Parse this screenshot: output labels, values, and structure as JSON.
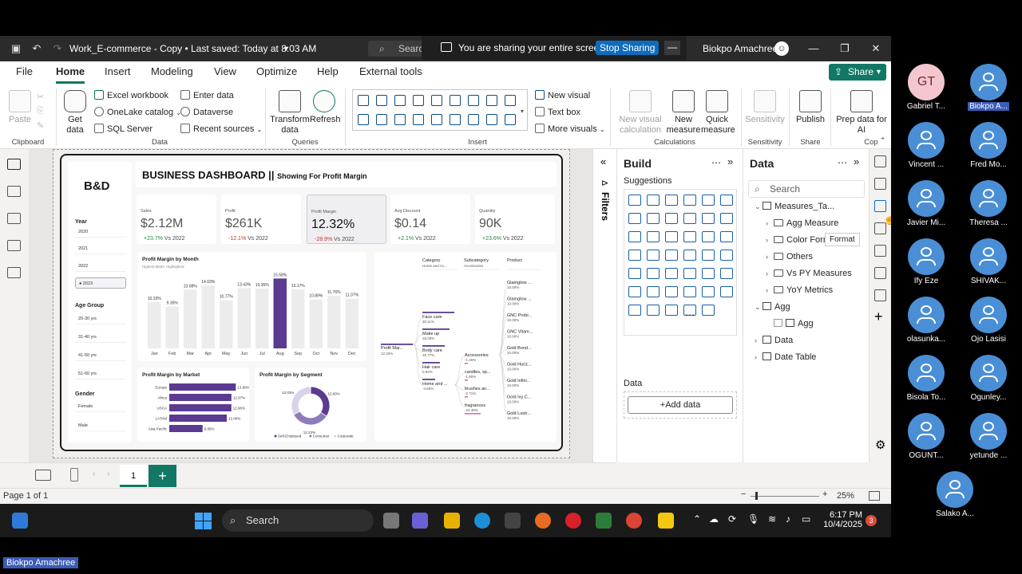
{
  "window": {
    "title": "Work_E-commerce - Copy • Last saved: Today at 8:03 AM",
    "search_placeholder": "Search",
    "user": "Biokpo Amachree"
  },
  "sharing": {
    "text": "You are sharing your entire screen.",
    "stop_label": "Stop Sharing",
    "min_label": "—"
  },
  "menu": {
    "items": [
      "File",
      "Home",
      "Insert",
      "Modeling",
      "View",
      "Optimize",
      "Help",
      "External tools"
    ],
    "active": "Home",
    "share_label": "Share"
  },
  "ribbon": {
    "clipboard": {
      "paste": "Paste",
      "label": "Clipboard"
    },
    "data": {
      "get_data": "Get data",
      "excel": "Excel workbook",
      "onelake": "OneLake catalog",
      "sql": "SQL Server",
      "enter": "Enter data",
      "dataverse": "Dataverse",
      "recent": "Recent sources",
      "label": "Data"
    },
    "queries": {
      "transform": "Transform data",
      "refresh": "Refresh",
      "label": "Queries"
    },
    "insert": {
      "new_visual": "New visual",
      "text_box": "Text box",
      "more_visuals": "More visuals",
      "label": "Insert"
    },
    "calculations": {
      "new_visual_calc": "New visual calculation",
      "new_measure": "New measure",
      "quick_measure": "Quick measure",
      "label": "Calculations"
    },
    "sensitivity": {
      "btn": "Sensitivity",
      "label": "Sensitivity"
    },
    "share": {
      "publish": "Publish",
      "label": "Share"
    },
    "copilot": {
      "prep": "Prep data for AI",
      "label": "Cop"
    }
  },
  "dashboard": {
    "brand": "B&D",
    "title": "BUSINESS DASHBOARD ||",
    "subtitle": "Showing For Profit Margin",
    "year_label": "Year",
    "years": [
      "2020",
      "2021",
      "2022",
      "2023"
    ],
    "selected_year": "2023",
    "age_label": "Age Group",
    "ages": [
      "20-30 yrs",
      "31-40 yrs",
      "41-50 yrs",
      "51-60 yrs"
    ],
    "gender_label": "Gender",
    "genders": [
      "Female",
      "Male"
    ],
    "kpis": [
      {
        "label": "Sales",
        "value": "$2.12M",
        "delta": "+23.7%",
        "vs": "Vs 2022",
        "dir": "pos"
      },
      {
        "label": "Profit",
        "value": "$261K",
        "delta": "-12.1%",
        "vs": "Vs 2022",
        "dir": "neg"
      },
      {
        "label": "Profit Margin",
        "value": "12.32%",
        "delta": "-28.9%",
        "vs": "Vs 2022",
        "dir": "neg"
      },
      {
        "label": "Avg Discount",
        "value": "$0.14",
        "delta": "+2.1%",
        "vs": "Vs 2022",
        "dir": "pos"
      },
      {
        "label": "Quantity",
        "value": "90K",
        "delta": "+23.6%",
        "vs": "Vs 2022",
        "dir": "pos"
      }
    ],
    "month_chart": {
      "title": "Profit Margin by Month",
      "subtitle": "Highest Metric Highlighted"
    },
    "market_chart": {
      "title": "Profit Margin by Market"
    },
    "segment_chart": {
      "title": "Profit Margin by Segment"
    },
    "tree": {
      "headers": [
        {
          "h": "Category",
          "s": "Home and Ac..."
        },
        {
          "h": "Subcategory",
          "s": "Accessories"
        },
        {
          "h": "Product",
          "s": ""
        }
      ],
      "root": {
        "label": "Profit Mar...",
        "value": "12.32%"
      },
      "categories": [
        {
          "label": "Face care",
          "value": "30.11%"
        },
        {
          "label": "Make up",
          "value": "25.00%"
        },
        {
          "label": "Body care",
          "value": "16.77%"
        },
        {
          "label": "Hair care",
          "value": "0.92%"
        },
        {
          "label": "Home and ...",
          "value": "-4.60%"
        }
      ],
      "subcategories": [
        {
          "label": "Accessories",
          "value": "-1.45%"
        },
        {
          "label": "candles, sp...",
          "value": "-1.80%"
        },
        {
          "label": "brushes an...",
          "value": "-2.71%"
        },
        {
          "label": "fragrances",
          "value": "-24.38%"
        }
      ],
      "products": [
        {
          "label": "Glamglow ...",
          "value": "10.00%"
        },
        {
          "label": "Glamglow ...",
          "value": "10.00%"
        },
        {
          "label": "GNC Probi...",
          "value": "10.00%"
        },
        {
          "label": "GNC Vitam...",
          "value": "10.00%"
        },
        {
          "label": "Gold Bond...",
          "value": "10.00%"
        },
        {
          "label": "Gold Horiz...",
          "value": "10.00%"
        },
        {
          "label": "Gold Infini...",
          "value": "10.00%"
        },
        {
          "label": "Gold Ivy C...",
          "value": "10.00%"
        },
        {
          "label": "Gold Lustr...",
          "value": "10.00%"
        }
      ]
    }
  },
  "chart_data": [
    {
      "type": "bar",
      "title": "Profit Margin by Month",
      "subtitle": "Highest Metric Highlighted",
      "categories": [
        "Jan",
        "Feb",
        "Mar",
        "Apr",
        "May",
        "Jun",
        "Jul",
        "Aug",
        "Sep",
        "Oct",
        "Nov",
        "Dec"
      ],
      "values": [
        10.33,
        9.35,
        13.08,
        14.03,
        10.77,
        13.43,
        13.35,
        15.58,
        13.17,
        10.89,
        11.76,
        11.07
      ],
      "labels": [
        "10.33%",
        "9.35%",
        "13.08%",
        "14.03%",
        "10.77%",
        "13.43%",
        "13.35%",
        "15.58%",
        "13.17%",
        "10.89%",
        "11.76%",
        "11.07%"
      ],
      "highlight": "Aug",
      "ylim": [
        0,
        16
      ]
    },
    {
      "type": "bar",
      "orientation": "horizontal",
      "title": "Profit Margin by Market",
      "categories": [
        "Europe",
        "Africa",
        "USCA",
        "LATAM",
        "Asia Pacific"
      ],
      "values": [
        13.89,
        12.97,
        12.96,
        12.0,
        6.95
      ],
      "labels": [
        "13.89%",
        "12.97%",
        "12.96%",
        "12.00%",
        "6.95%"
      ],
      "xlim": [
        0,
        14
      ]
    },
    {
      "type": "pie",
      "donut": true,
      "title": "Profit Margin by Segment",
      "categories": [
        "Self-Employed",
        "Consumer",
        "Corporate"
      ],
      "values": [
        12.6,
        12.23,
        12.03
      ],
      "labels": [
        "12.60%",
        "12.23%",
        "12.03%"
      ],
      "colors": [
        "#5b3a91",
        "#8e7bbd",
        "#d9d2ea"
      ],
      "legend": "bottom"
    }
  ],
  "panes": {
    "filters": "Filters",
    "build": {
      "title": "Build",
      "suggestions": "Suggestions",
      "data_label": "Data",
      "add_data": "+Add data"
    },
    "data": {
      "title": "Data",
      "search_placeholder": "Search",
      "tooltip": "Format",
      "tree": [
        {
          "text": "Measures_Ta...",
          "level": 0,
          "kind": "table",
          "open": true
        },
        {
          "text": "Agg Measure",
          "level": 1,
          "kind": "folder"
        },
        {
          "text": "Color Format",
          "level": 1,
          "kind": "folder"
        },
        {
          "text": "Others",
          "level": 1,
          "kind": "folder"
        },
        {
          "text": "Vs PY Measures",
          "level": 1,
          "kind": "folder"
        },
        {
          "text": "YoY Metrics",
          "level": 1,
          "kind": "folder"
        },
        {
          "text": "Agg",
          "level": 0,
          "kind": "table",
          "open": true
        },
        {
          "text": "Agg",
          "level": 1,
          "kind": "field"
        },
        {
          "text": "Data",
          "level": 0,
          "kind": "table",
          "open": false
        },
        {
          "text": "Date Table",
          "level": 0,
          "kind": "table",
          "open": false
        }
      ]
    }
  },
  "pages": {
    "current": "1",
    "add": "+"
  },
  "status": {
    "page": "Page 1 of 1",
    "zoom": "25%"
  },
  "taskbar": {
    "search": "Search",
    "time": "6:17 PM",
    "date": "10/4/2025",
    "badge": "3"
  },
  "participants": [
    {
      "name": "Gabriel T...",
      "initials": "GT"
    },
    {
      "name": "Biokpo A...",
      "highlight": true
    },
    {
      "name": "Vincent ..."
    },
    {
      "name": "Fred Mo..."
    },
    {
      "name": "Javier Mi..."
    },
    {
      "name": "Theresa ..."
    },
    {
      "name": "Ify Eze"
    },
    {
      "name": "SHIVAK..."
    },
    {
      "name": "olasunka..."
    },
    {
      "name": "Ojo Lasisi"
    },
    {
      "name": "Bisola To..."
    },
    {
      "name": "Ogunley..."
    },
    {
      "name": "OGUNT..."
    },
    {
      "name": "yetunde ..."
    },
    {
      "name": "Salako A..."
    }
  ],
  "presenter_tag": "Biokpo Amachree"
}
